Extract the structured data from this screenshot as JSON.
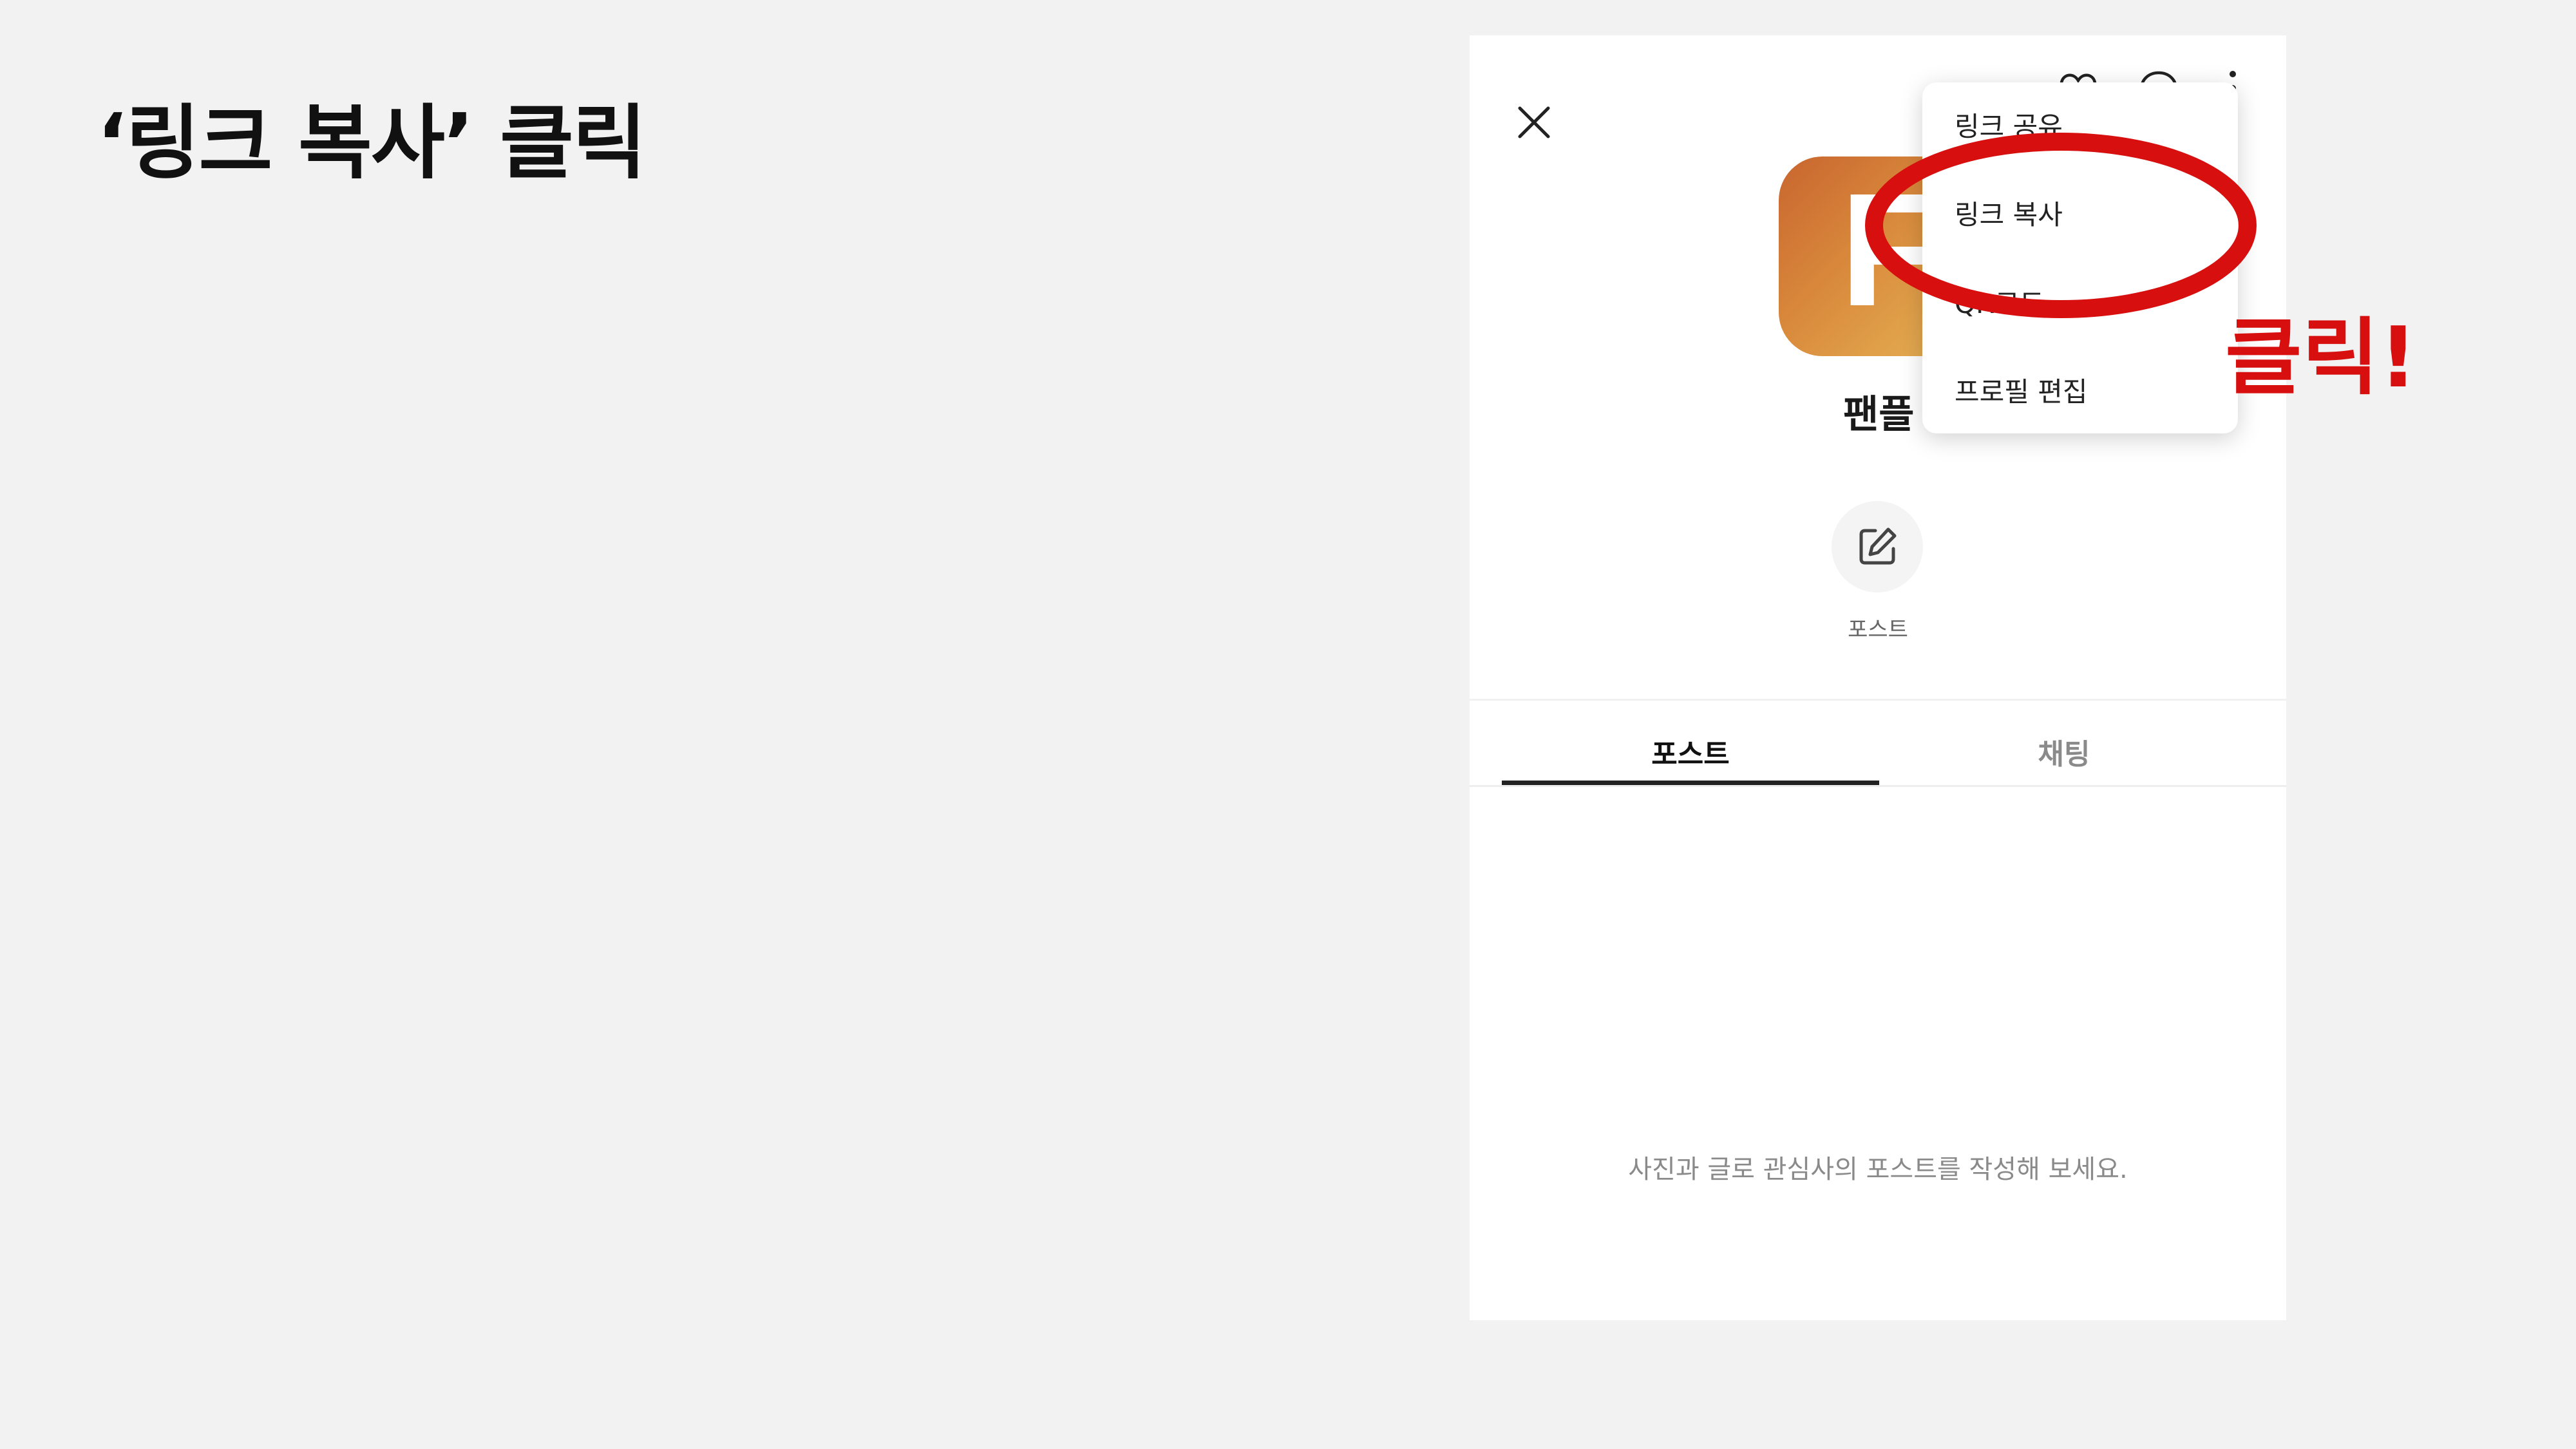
{
  "slide": {
    "title": "‘링크 복사’ 클릭",
    "callout": "클릭!"
  },
  "header": {
    "close_icon": "close-icon",
    "icons": [
      "heart-icon",
      "chat-bubble-icon",
      "more-vertical-icon"
    ]
  },
  "profile": {
    "avatar_letter": "F",
    "name": "팬플",
    "post_button_label": "포스트"
  },
  "tabs": [
    {
      "label": "포스트",
      "active": true
    },
    {
      "label": "채팅",
      "active": false
    }
  ],
  "empty_state": "사진과 글로 관심사의 포스트를 작성해 보세요.",
  "menu": {
    "items": [
      {
        "label": "링크 공유"
      },
      {
        "label": "링크 복사",
        "highlighted": true
      },
      {
        "label": "QR코드"
      },
      {
        "label": "프로필 편집"
      }
    ]
  },
  "colors": {
    "background": "#f2f2f2",
    "highlight": "#d70f0f",
    "avatar_gradient": [
      "#c8652f",
      "#e6b456"
    ]
  }
}
